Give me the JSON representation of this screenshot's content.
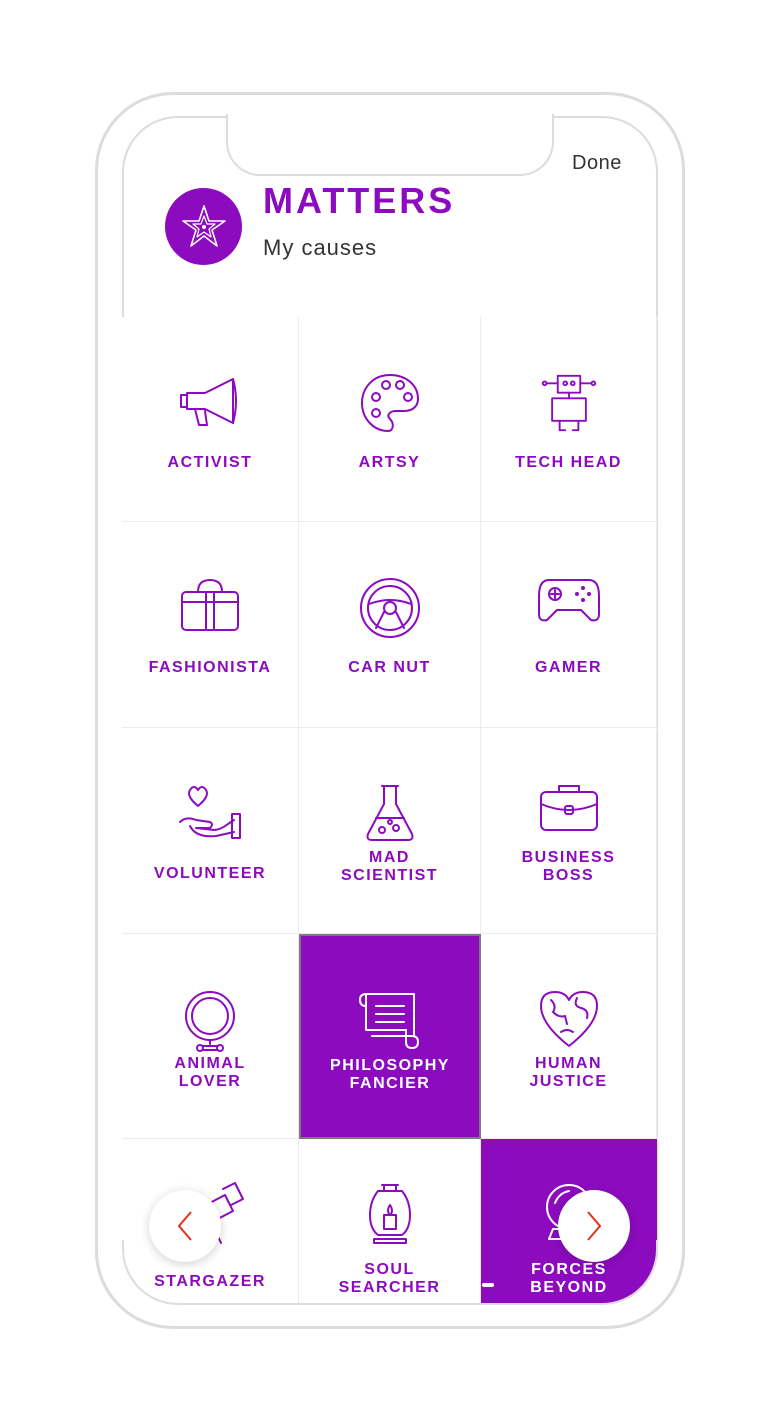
{
  "header": {
    "done_label": "Done",
    "brand": "MATTERS",
    "subtitle": "My causes",
    "logo_icon": "star-icon"
  },
  "colors": {
    "accent": "#8c0bbf",
    "border": "#ececec",
    "frame": "#dcdcdc",
    "arrow": "#e0331a"
  },
  "causes": [
    {
      "label": "ACTIVIST",
      "icon": "megaphone-icon",
      "selected": false
    },
    {
      "label": "ARTSY",
      "icon": "palette-icon",
      "selected": false
    },
    {
      "label": "TECH HEAD",
      "icon": "robot-icon",
      "selected": false
    },
    {
      "label": "FASHIONISTA",
      "icon": "handbag-icon",
      "selected": false
    },
    {
      "label": "CAR NUT",
      "icon": "steering-wheel-icon",
      "selected": false
    },
    {
      "label": "GAMER",
      "icon": "gamepad-icon",
      "selected": false
    },
    {
      "label": "VOLUNTEER",
      "icon": "heart-hand-icon",
      "selected": false
    },
    {
      "label": "MAD\nSCIENTIST",
      "icon": "flask-icon",
      "selected": false
    },
    {
      "label": "BUSINESS\nBOSS",
      "icon": "briefcase-icon",
      "selected": false
    },
    {
      "label": "ANIMAL\nLOVER",
      "icon": "pet-tag-icon",
      "selected": false
    },
    {
      "label": "PHILOSOPHY\nFANCIER",
      "icon": "scroll-icon",
      "selected": true
    },
    {
      "label": "HUMAN\nJUSTICE",
      "icon": "heart-globe-icon",
      "selected": false
    },
    {
      "label": "STARGAZER",
      "icon": "telescope-icon",
      "selected": false
    },
    {
      "label": "SOUL\nSEARCHER",
      "icon": "lantern-icon",
      "selected": false
    },
    {
      "label": "FORCES\nBEYOND",
      "icon": "crystal-ball-icon",
      "selected": true
    }
  ],
  "nav": {
    "prev_icon": "chevron-left-icon",
    "next_icon": "chevron-right-icon"
  }
}
